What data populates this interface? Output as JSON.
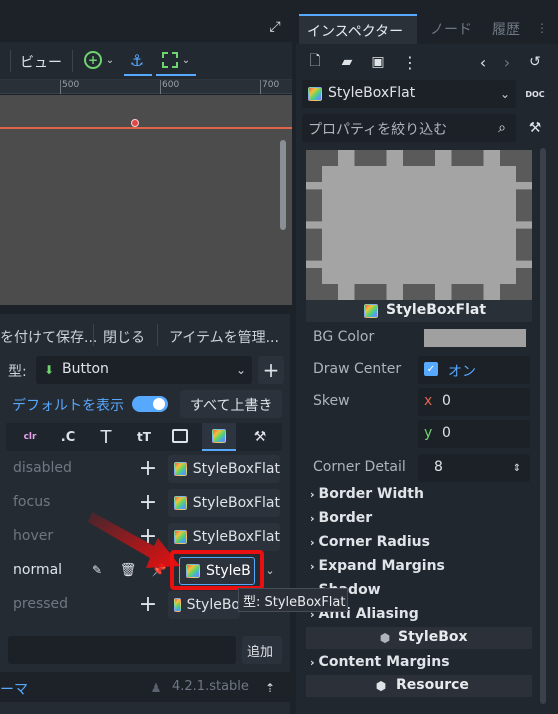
{
  "editor": {
    "view_menu": "ビュー",
    "ruler_ticks": [
      "500",
      "600",
      "700"
    ]
  },
  "theme": {
    "toolbar": {
      "save_label": "を付けて保存...",
      "close_label": "閉じる",
      "manage_label": "アイテムを管理..."
    },
    "type_label": "型:",
    "type_value": "Button",
    "show_default_label": "デフォルトを表示",
    "override_all_label": "すべて上書き",
    "tabs": [
      "clr",
      ".C",
      "T",
      "tT",
      "image",
      "stylebox",
      "constants"
    ],
    "properties": [
      {
        "name": "disabled",
        "value": "StyleBoxFlat",
        "state": "default"
      },
      {
        "name": "focus",
        "value": "StyleBoxFlat",
        "state": "default"
      },
      {
        "name": "hover",
        "value": "StyleBoxFlat",
        "state": "default"
      },
      {
        "name": "normal",
        "value": "StyleB",
        "state": "overridden"
      },
      {
        "name": "pressed",
        "value": "StyleBo",
        "state": "default"
      }
    ],
    "add_label": "追加",
    "footer_left": "ーマ",
    "version": "4.2.1.stable"
  },
  "tooltip": "型: StyleBoxFlat",
  "inspector": {
    "tabs": [
      "インスペクター",
      "ノード",
      "履歴"
    ],
    "resource_type": "StyleBoxFlat",
    "filter_placeholder": "プロパティを絞り込む",
    "preview_label": "StyleBoxFlat",
    "bg_color_label": "BG Color",
    "bg_color_value": "#a0a0a0",
    "draw_center_label": "Draw Center",
    "draw_center_value": "オン",
    "skew_label": "Skew",
    "skew_x": "0",
    "skew_y": "0",
    "corner_detail_label": "Corner Detail",
    "corner_detail_value": "8",
    "groups": [
      "Border Width",
      "Border",
      "Corner Radius",
      "Expand Margins",
      "Shadow",
      "Anti Aliasing"
    ],
    "stylebox_section": "StyleBox",
    "content_margins_group": "Content Margins",
    "resource_section": "Resource"
  },
  "colors": {
    "accent": "#57a8ff",
    "highlight": "#e81010",
    "guide_line": "#e0644a"
  }
}
